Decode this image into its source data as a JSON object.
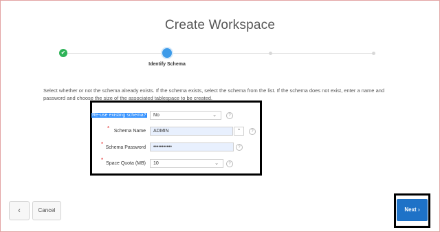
{
  "page": {
    "title": "Create Workspace"
  },
  "wizard": {
    "current_step_label": "Identify Schema",
    "done_icon": "✔"
  },
  "instructions": "Select whether or not the schema already exists. If the schema exists, select the schema from the list. If the schema does not exist, enter a name and password and choose the size of the associated tablespace to be created.",
  "form": {
    "reuse_schema": {
      "label": "Re-use existing schema?",
      "value": "No"
    },
    "schema_name": {
      "label": "Schema Name",
      "value": "ADMIN",
      "required": "*"
    },
    "schema_password": {
      "label": "Schema Password",
      "value": "•••••••••••",
      "required": "*"
    },
    "space_quota": {
      "label": "Space Quota (MB)",
      "value": "10",
      "required": "*"
    },
    "help_glyph": "?",
    "chevron_down": "⌄",
    "chevron_up": "⌃"
  },
  "footer": {
    "back_glyph": "‹",
    "cancel_label": "Cancel",
    "next_label": "Next",
    "next_glyph": "›"
  },
  "colors": {
    "accent": "#3d9be9",
    "done": "#2eb358",
    "next_button": "#1e72c7",
    "required": "#e02020"
  }
}
